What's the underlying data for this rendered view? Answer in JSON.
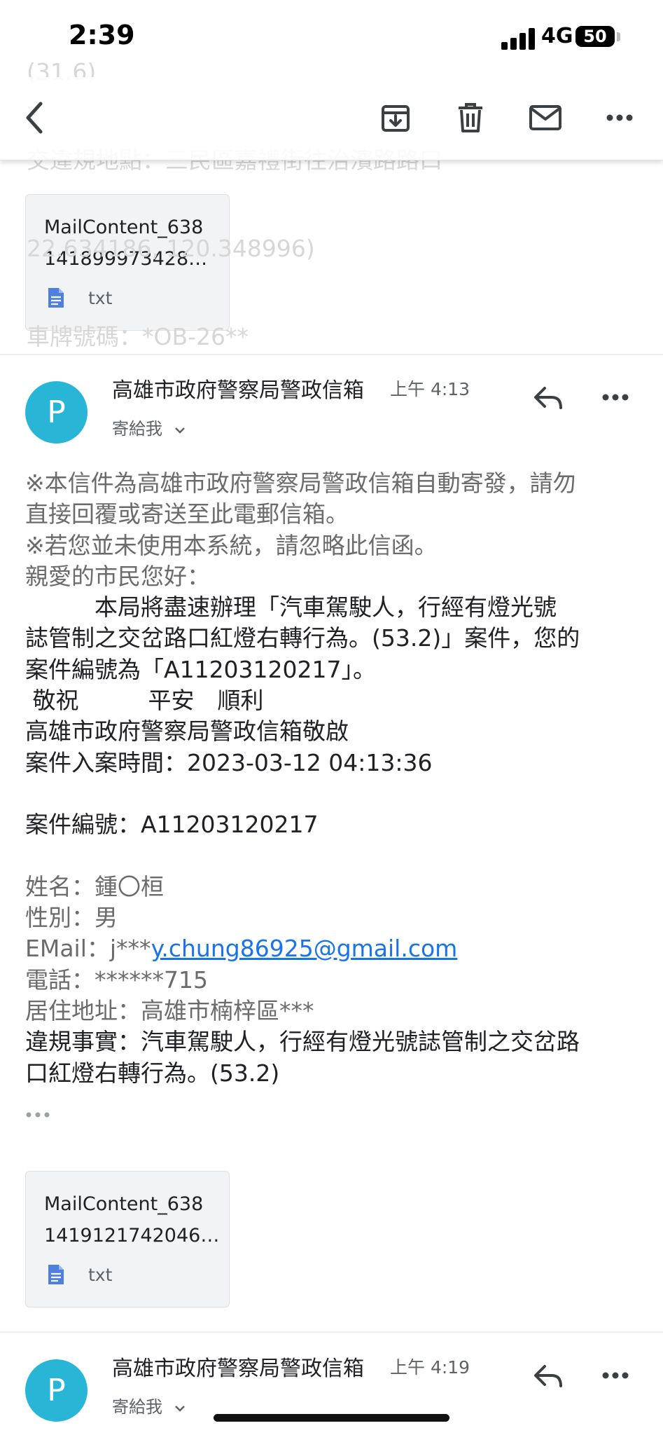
{
  "ghost_lines": [
    "(31.6)",
    "交違規地點：三民區嘉禮街往治濱路路口",
    "22.634186, 120.348996)",
    "車牌號碼：*OB-26**"
  ],
  "status_bar": {
    "time": "2:39",
    "network": "4G",
    "battery": "50"
  },
  "toolbar": {
    "icons": [
      "back-arrow-icon",
      "archive-icon",
      "trash-icon",
      "mail-icon",
      "more-vert-icon"
    ]
  },
  "attachments": [
    {
      "name_line1": "MailContent_638",
      "name_line2": "141899973428…",
      "type": "txt",
      "icon": "text-file-icon"
    },
    {
      "name_line1": "MailContent_638",
      "name_line2": "1419121742046…",
      "type": "txt",
      "icon": "text-file-icon"
    }
  ],
  "messages": [
    {
      "avatar_letter": "P",
      "sender": "高雄市政府警察局警政信箱",
      "time": "上午 4:13",
      "recipient": "寄給我"
    },
    {
      "avatar_letter": "P",
      "sender": "高雄市政府警察局警政信箱",
      "time": "上午 4:19",
      "recipient": "寄給我"
    }
  ],
  "body": {
    "notice1_a": "※本信件為高雄市政府警察局警政信箱自動寄發，請勿",
    "notice1_b": "直接回覆或寄送至此電郵信箱。",
    "notice2": "※若您並未使用本系統，請忽略此信函。",
    "greeting": "親愛的市民您好：",
    "para_1": "　　　本局將盡速辦理「汽車駕駛人，行經有燈光號",
    "para_2": "誌管制之交岔路口紅燈右轉行為。(53.2)」案件，您的",
    "para_3": "案件編號為「A11203120217」。",
    "regards": " 敬祝　　　平安　順利",
    "signature": "高雄市政府警察局警政信箱敬啟",
    "filed_time": "案件入案時間：2023-03-12 04:13:36",
    "case_no": "案件編號：A11203120217",
    "name": "姓名：鍾〇桓",
    "gender": "性別：男",
    "email_label": "EMail：j***",
    "email_link": "y.chung86925@gmail.com",
    "phone": "電話：******715",
    "address": "居住地址：高雄市楠梓區***",
    "violation_a": "違規事實：汽車駕駛人，行經有燈光號誌管制之交岔路",
    "violation_b": "口紅燈右轉行為。(53.2)"
  },
  "colors": {
    "avatar": "#29b6d6",
    "link": "#1a73e8",
    "file_icon": "#4f7fe0"
  }
}
